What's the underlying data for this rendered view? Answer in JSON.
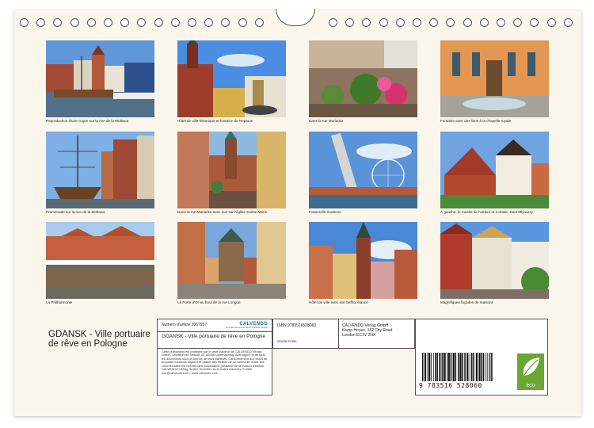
{
  "captions": [
    "Reproduction d'une cogue sur la rive de la Motlawa",
    "Hôtel de ville historique et fontaine de Neptune",
    "Dans la rue Mariacka",
    "Fontaine avec des lions à la chapelle royale",
    "Promenade sur la rive de la Motlawa",
    "Dans la rue Mariacka avec vue sur l'église Sainte-Marie",
    "Passerelle moderne",
    "À gauche, le musée de l'ambre et à droite, Dom Mlynarzy",
    "La Philharmonie",
    "La Porte d'Or au bout de la rue Longue",
    "Hôtel de ville avec son beffroi élancé",
    "Magnifiques façades de maisons"
  ],
  "title": "GDANSK - Ville portuaire de rêve en Pologne",
  "article": {
    "label": "Numéro d'article 2067957",
    "brand": "CALVENDO",
    "brand_sub": "ein Unternehmen der Ulmer Calvendo Gruppe",
    "title": "GDANSK - Ville portuaire de rêve en Pologne",
    "legal": "Cette publication est protégée par le droit d'auteur de CALVENDO Verlag GmbH, Ottobrunner Strasse 39, 82008 Unterhaching, Allemagne, et de tous les documents sous la licence de leurs bailleurs. Conformément aux droits de propriété existants séparer et utiliser des feuilles de ce calendrier à des fins commerciales est interdit sans autorisation préalable de la maison d'édition CALVENDO Verlag GmbH. Données sous toutes réserves. E-Mail: info@calvendo.com • www.calvendo.com"
  },
  "isbn": "ISBN 9783516528060",
  "author": "Gisela Kruse",
  "publisher": [
    "CALVENDO Verlag GmbH",
    "Kemp House, 152 City Road",
    "London EC1V 2NX"
  ],
  "barcode": {
    "number": "9 783516 528060",
    "digits": "9783516528060"
  },
  "eco_label": "eco"
}
